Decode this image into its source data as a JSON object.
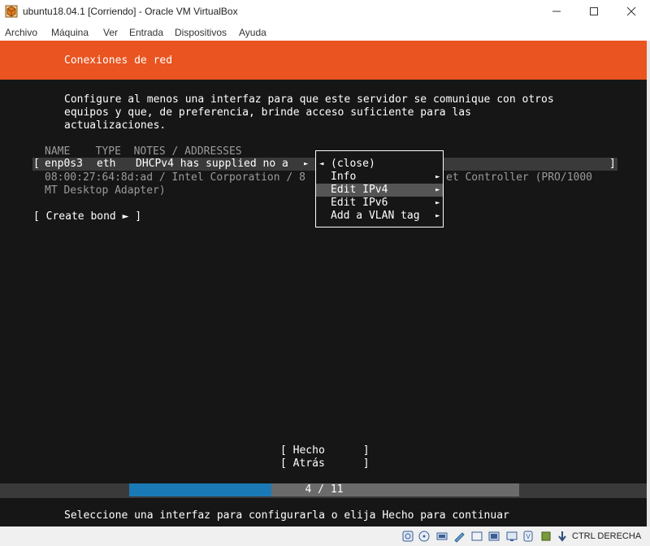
{
  "window": {
    "title": "ubuntu18.04.1 [Corriendo] - Oracle VM VirtualBox"
  },
  "menubar": {
    "items": [
      "Archivo",
      "Máquina",
      "Ver",
      "Entrada",
      "Dispositivos",
      "Ayuda"
    ]
  },
  "vm": {
    "header_title": "Conexiones de red",
    "description": [
      "Configure al menos una interfaz para que este servidor se comunique con otros",
      "equipos y que, de preferencia, brinde acceso suficiente para las",
      "actualizaciones."
    ],
    "table_header": "NAME    TYPE  NOTES / ADDRESSES",
    "row_open": "[",
    "row_name": "enp0s3",
    "row_type": "eth",
    "row_notes": "DHCPv4 has supplied no a",
    "row_arrow": "►",
    "row_close": "]",
    "row_detail_1_left": "08:00:27:64:8d:ad / Intel Corporation / 8",
    "row_detail_1_right": "et Controller (PRO/1000",
    "row_detail_2": "MT Desktop Adapter)",
    "create_bond": "[ Create bond ► ]",
    "context_menu": [
      {
        "label": "(close)",
        "arrow_left": "◄",
        "arrow": "",
        "selected": false
      },
      {
        "label": "Info",
        "arrow_left": "",
        "arrow": "►",
        "selected": false
      },
      {
        "label": "Edit IPv4",
        "arrow_left": "",
        "arrow": "►",
        "selected": true
      },
      {
        "label": "Edit IPv6",
        "arrow_left": "",
        "arrow": "►",
        "selected": false
      },
      {
        "label": "Add a VLAN tag",
        "arrow_left": "",
        "arrow": "►",
        "selected": false
      }
    ],
    "done_button": "[ Hecho      ]",
    "back_button": "[ Atrás      ]",
    "progress": {
      "label": "4 / 11",
      "current": 4,
      "total": 11,
      "fill_color": "#1a7ab6"
    },
    "footer": "Seleccione una interfaz para configurarla o elija Hecho para continuar"
  },
  "statusbar": {
    "icons": [
      "hard-disk-icon",
      "optical-drive-icon",
      "audio-icon",
      "network-icon",
      "usb-icon",
      "shared-folder-icon",
      "display-icon",
      "video-capture-icon",
      "cpu-icon",
      "mouse-integration-icon"
    ],
    "host_key": "CTRL DERECHA"
  },
  "colors": {
    "accent": "#e95420",
    "terminal_bg": "#161616",
    "dim_text": "#9b9b9b",
    "progress_fill": "#1a7ab6",
    "progress_track": "#6b6b6b"
  }
}
